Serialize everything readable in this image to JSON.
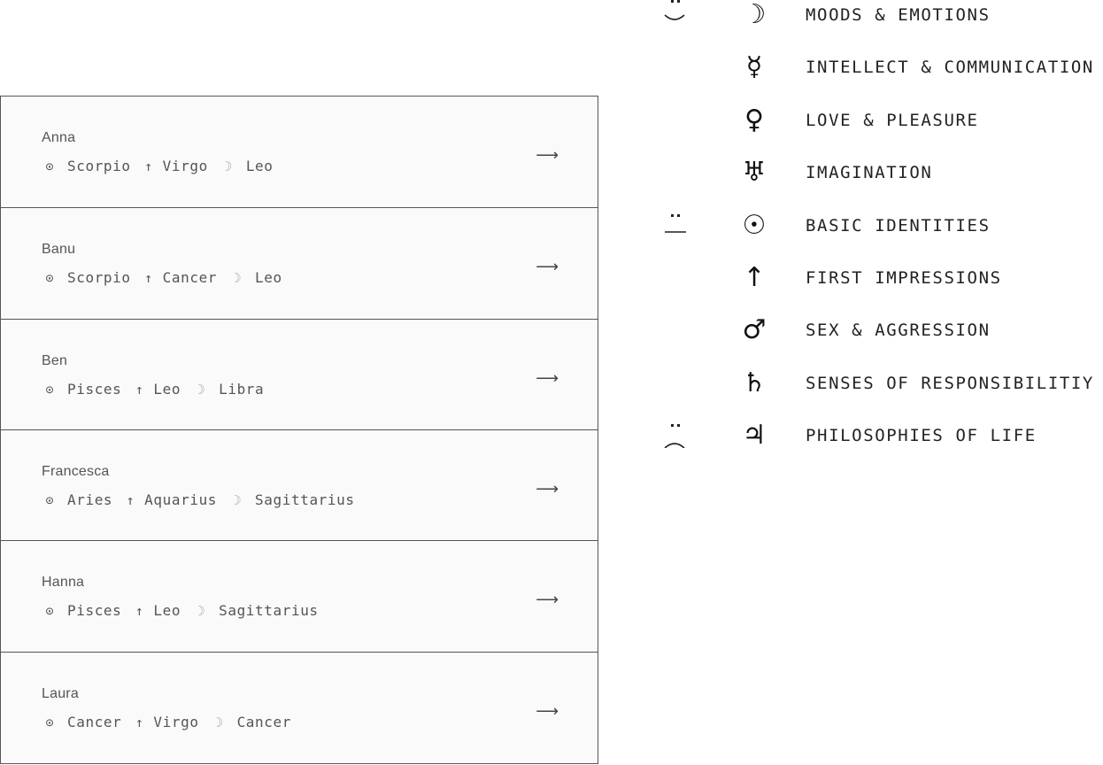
{
  "people": [
    {
      "name": "Anna",
      "sun": "Scorpio",
      "rising": "Virgo",
      "moon": "Leo"
    },
    {
      "name": "Banu",
      "sun": "Scorpio",
      "rising": "Cancer",
      "moon": "Leo"
    },
    {
      "name": "Ben",
      "sun": "Pisces",
      "rising": "Leo",
      "moon": "Libra"
    },
    {
      "name": "Francesca",
      "sun": "Aries",
      "rising": "Aquarius",
      "moon": "Sagittarius"
    },
    {
      "name": "Hanna",
      "sun": "Pisces",
      "rising": "Leo",
      "moon": "Sagittarius"
    },
    {
      "name": "Laura",
      "sun": "Cancer",
      "rising": "Virgo",
      "moon": "Cancer"
    }
  ],
  "glyphs": {
    "sun": "⊙",
    "rising": "↑",
    "moon": "☽",
    "arrow": "⟶"
  },
  "legend": [
    {
      "mood": "happy",
      "planet": "moon",
      "glyph": "☽",
      "label": "MOODS & EMOTIONS"
    },
    {
      "mood": "",
      "planet": "mercury",
      "glyph": "☿",
      "label": "INTELLECT & COMMUNICATION"
    },
    {
      "mood": "",
      "planet": "venus",
      "glyph": "♀",
      "label": "LOVE & PLEASURE"
    },
    {
      "mood": "",
      "planet": "uranus",
      "glyph": "♅",
      "label": "IMAGINATION"
    },
    {
      "mood": "neutral",
      "planet": "sun",
      "glyph": "☉",
      "label": "BASIC IDENTITIES"
    },
    {
      "mood": "",
      "planet": "ascendant",
      "glyph": "↑",
      "label": "FIRST IMPRESSIONS"
    },
    {
      "mood": "",
      "planet": "mars",
      "glyph": "♂",
      "label": "SEX & AGGRESSION"
    },
    {
      "mood": "",
      "planet": "saturn",
      "glyph": "♄",
      "label": "SENSES OF RESPONSIBILITIY"
    },
    {
      "mood": "sad",
      "planet": "jupiter",
      "glyph": "♃",
      "label": "PHILOSOPHIES OF LIFE"
    }
  ]
}
